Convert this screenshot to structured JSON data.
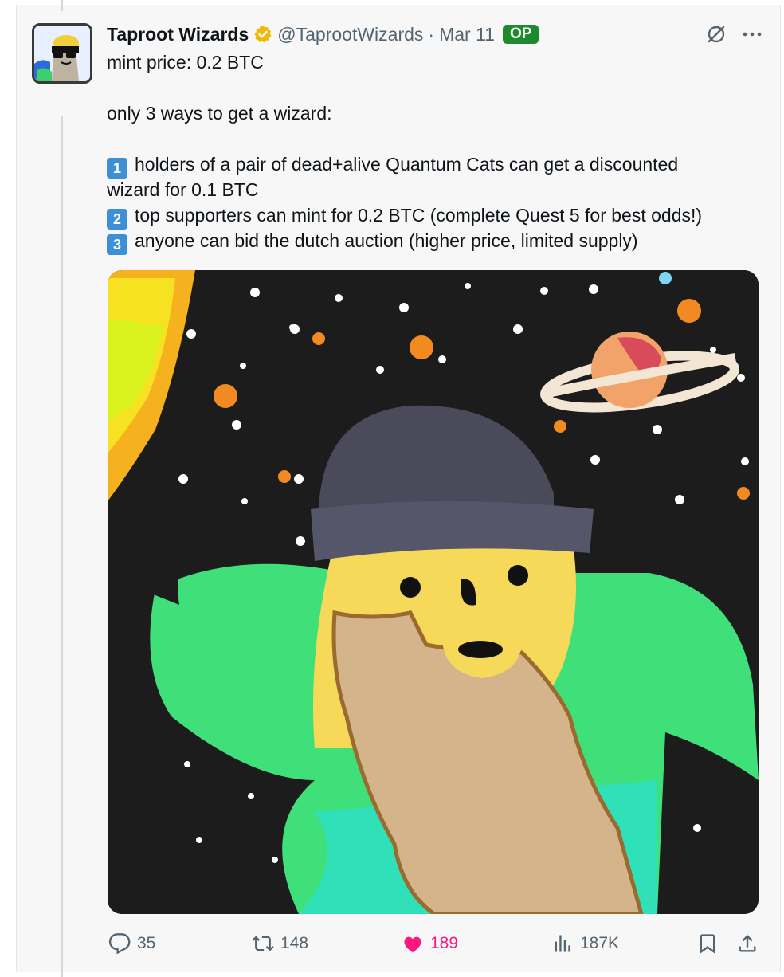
{
  "tweet": {
    "display_name": "Taproot Wizards",
    "handle": "@TaprootWizards",
    "separator": "·",
    "date": "Mar 11",
    "op_badge": "OP",
    "lines": {
      "l1": "mint price: 0.2 BTC",
      "l2": "only 3 ways to get a wizard:",
      "l3": "holders of a pair of dead+alive Quantum Cats can get a discounted",
      "l4": "wizard for 0.1 BTC",
      "l5": "top supporters can mint for 0.2 BTC (complete Quest 5 for best odds!)",
      "l6": "anyone can bid the dutch auction (higher price, limited supply)"
    },
    "numbers": {
      "n1": "1",
      "n2": "2",
      "n3": "3"
    }
  },
  "actions": {
    "replies": "35",
    "reposts": "148",
    "likes": "189",
    "views": "187K"
  },
  "icons": {
    "verified": "verified-badge-icon",
    "grok": "grok-icon",
    "more": "more-icon",
    "reply": "reply-icon",
    "repost": "repost-icon",
    "like": "heart-icon",
    "views": "views-icon",
    "bookmark": "bookmark-icon",
    "share": "share-icon"
  },
  "colors": {
    "like_active": "#f91880",
    "op_badge": "#1e8a2e",
    "verified": "#f0b90b",
    "number_tile": "#3d8fd8"
  }
}
